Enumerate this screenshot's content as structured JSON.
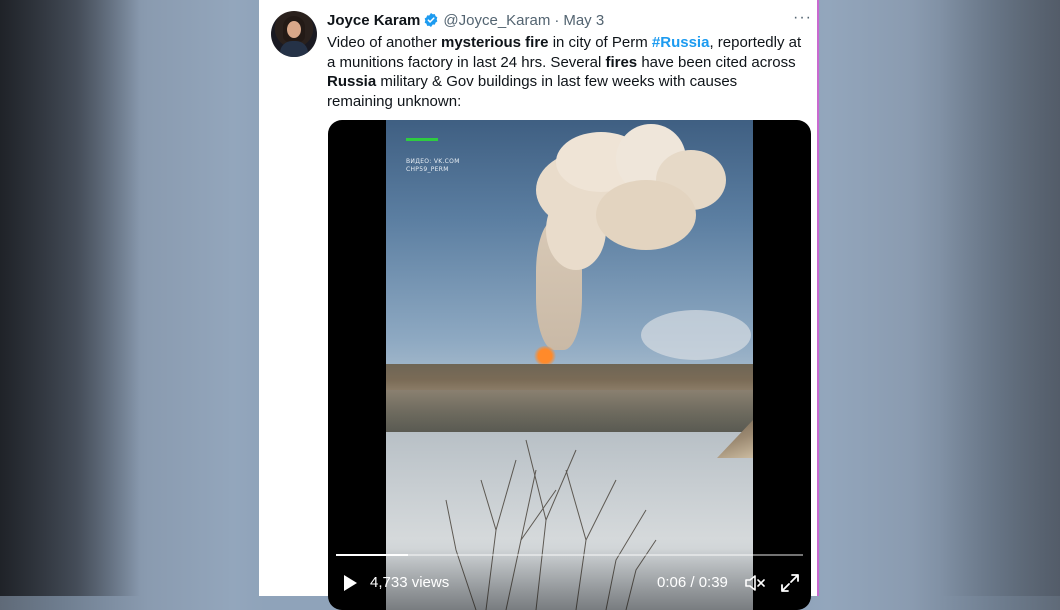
{
  "tweet": {
    "author_name": "Joyce Karam",
    "handle": "@Joyce_Karam",
    "separator": "·",
    "date": "May 3",
    "more_label": "···",
    "text_parts": [
      {
        "text": "Video of another ",
        "style": "normal"
      },
      {
        "text": "mysterious fire",
        "style": "bold"
      },
      {
        "text": " in city of Perm ",
        "style": "normal"
      },
      {
        "text": "#Russia",
        "style": "hashtag"
      },
      {
        "text": ", reportedly at a munitions factory in last 24 hrs. Several ",
        "style": "normal"
      },
      {
        "text": "fires",
        "style": "bold"
      },
      {
        "text": " have been cited across ",
        "style": "normal"
      },
      {
        "text": "Russia",
        "style": "bold"
      },
      {
        "text": " military & Gov buildings in last few weeks with causes remaining unknown:",
        "style": "normal"
      }
    ],
    "verified": true
  },
  "video": {
    "watermark_line1": "ВИДЕО: VK.COM",
    "watermark_line2": "CHP59_PERM",
    "views": "4,733 views",
    "time": "0:06 / 0:39",
    "progress_fraction": 0.154
  },
  "colors": {
    "hashtag": "#1d9bf0",
    "verified_badge": "#1d9bf0",
    "text": "#0f1419",
    "muted": "#536471"
  },
  "icons": {
    "verified": "verified-badge-icon",
    "more": "more-dots-icon",
    "play": "play-icon",
    "mute": "muted-speaker-icon",
    "fullscreen": "fullscreen-expand-icon"
  }
}
